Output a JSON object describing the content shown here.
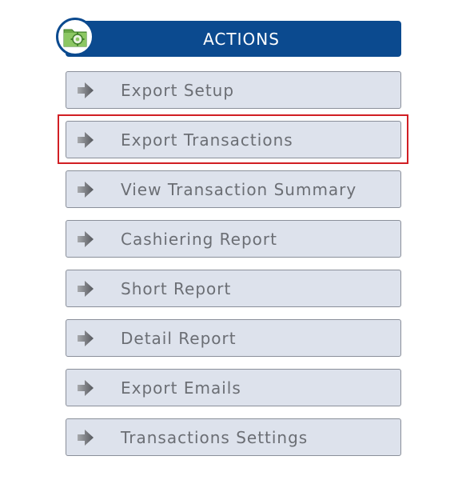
{
  "header": {
    "title": "ACTIONS",
    "badge_icon": "folder-gear-icon"
  },
  "actions": [
    {
      "label": "Export Setup",
      "icon": "arrow-right-icon"
    },
    {
      "label": "Export Transactions",
      "icon": "arrow-right-icon",
      "highlighted": true
    },
    {
      "label": "View Transaction Summary",
      "icon": "arrow-right-icon"
    },
    {
      "label": "Cashiering Report",
      "icon": "arrow-right-icon"
    },
    {
      "label": "Short Report",
      "icon": "arrow-right-icon"
    },
    {
      "label": "Detail Report",
      "icon": "arrow-right-icon"
    },
    {
      "label": "Export Emails",
      "icon": "arrow-right-icon"
    },
    {
      "label": "Transactions Settings",
      "icon": "arrow-right-icon"
    }
  ],
  "colors": {
    "header_bg": "#0b4a8f",
    "button_bg": "#dde2ec",
    "highlight_border": "#d11f24",
    "label_text": "#6b6e74"
  }
}
